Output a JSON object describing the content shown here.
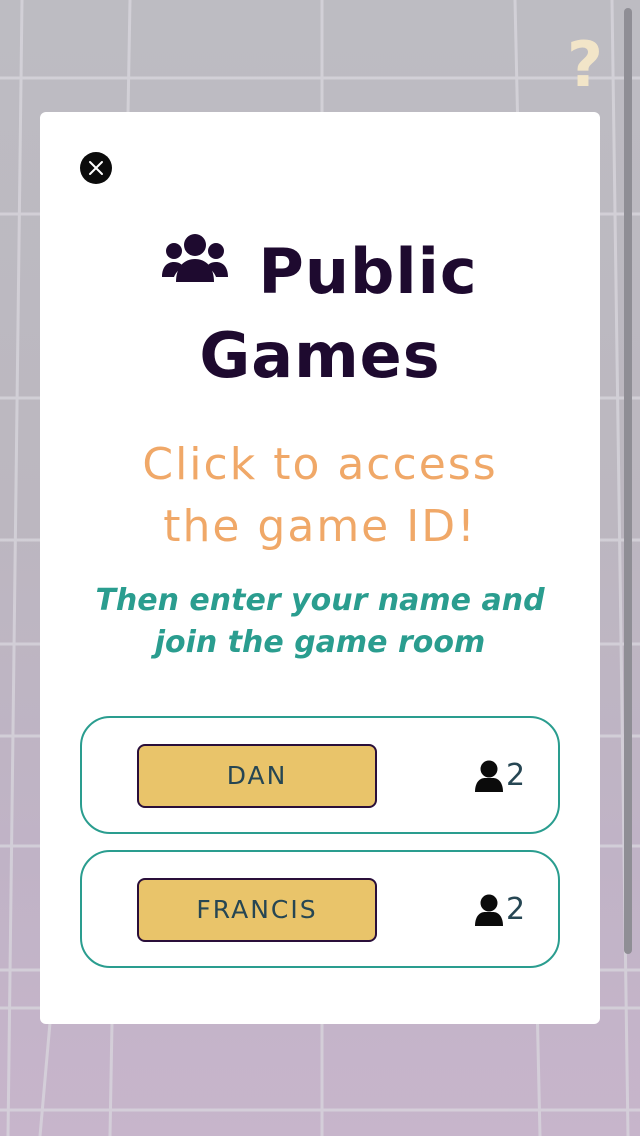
{
  "help": {
    "icon": "question-mark-icon",
    "label": "?"
  },
  "modal": {
    "close_icon": "close-icon",
    "title_icon": "users-icon",
    "title_line1": "Public",
    "title_line2": "Games",
    "subtitle_line1": "Click to access",
    "subtitle_line2": "the game ID!",
    "instruction_line1": "Then enter your name and",
    "instruction_line2": "join the game room",
    "games": [
      {
        "name": "DAN",
        "player_icon": "user-icon",
        "players": "2"
      },
      {
        "name": "FRANCIS",
        "player_icon": "user-icon",
        "players": "2"
      }
    ]
  },
  "colors": {
    "title": "#1e0a2f",
    "subtitle": "#f0a868",
    "instruction": "#2a9d8f",
    "button_fill": "#e9c46a",
    "button_text": "#264653",
    "help_icon": "#f2e5c8"
  }
}
